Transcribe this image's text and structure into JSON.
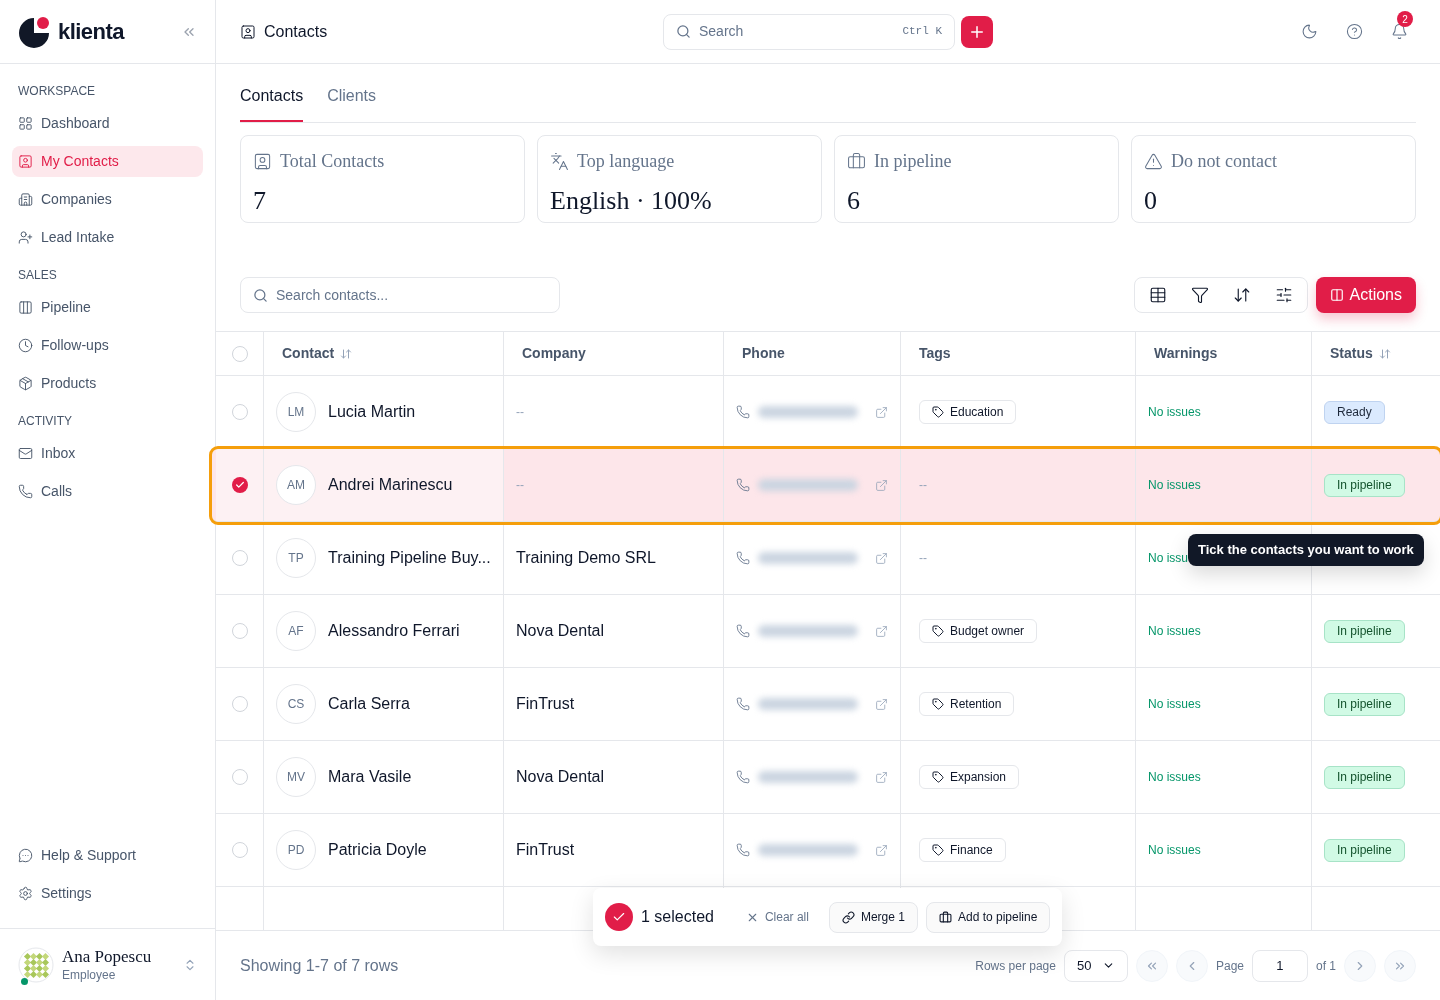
{
  "sidebar": {
    "logo": "klienta",
    "sections": [
      {
        "title": "WORKSPACE",
        "items": [
          {
            "label": "Dashboard",
            "selected": false
          },
          {
            "label": "My Contacts",
            "selected": true
          },
          {
            "label": "Companies",
            "selected": false
          },
          {
            "label": "Lead Intake",
            "selected": false
          }
        ]
      },
      {
        "title": "SALES",
        "items": [
          {
            "label": "Pipeline",
            "selected": false
          },
          {
            "label": "Follow-ups",
            "selected": false
          },
          {
            "label": "Products",
            "selected": false
          }
        ]
      },
      {
        "title": "ACTIVITY",
        "items": [
          {
            "label": "Inbox",
            "selected": false
          },
          {
            "label": "Calls",
            "selected": false
          }
        ]
      }
    ],
    "footer_items": [
      "Help & Support",
      "Settings"
    ],
    "user": {
      "name": "Ana Popescu",
      "role": "Employee",
      "online": true
    }
  },
  "header": {
    "title": "Contacts",
    "search": {
      "placeholder": "Search",
      "shortcut": "Ctrl K"
    },
    "notification_count": "2"
  },
  "tabs": [
    {
      "label": "Contacts",
      "selected": true
    },
    {
      "label": "Clients",
      "selected": false
    }
  ],
  "stats": [
    {
      "label": "Total Contacts",
      "value": "7"
    },
    {
      "label": "Top language",
      "value": "English · 100%"
    },
    {
      "label": "In pipeline",
      "value": "6"
    },
    {
      "label": "Do not contact",
      "value": "0"
    }
  ],
  "toolbar": {
    "search_placeholder": "Search contacts...",
    "actions": "Actions"
  },
  "table": {
    "select_all": {
      "checked": false
    },
    "columns": [
      {
        "label": "Contact",
        "sortable": true
      },
      {
        "label": "Company",
        "sortable": false
      },
      {
        "label": "Phone",
        "sortable": false
      },
      {
        "label": "Tags",
        "sortable": false
      },
      {
        "label": "Warnings",
        "sortable": false
      },
      {
        "label": "Status",
        "sortable": true
      }
    ],
    "rows": [
      {
        "initials": "LM",
        "name": "Lucia Martin",
        "company": "--",
        "tag": {
          "kind": "tag",
          "label": "Education"
        },
        "warning": "No issues",
        "status": {
          "kind": "ready",
          "label": "Ready"
        },
        "selected": false
      },
      {
        "initials": "AM",
        "name": "Andrei Marinescu",
        "company": "--",
        "tag": {
          "kind": "empty",
          "label": "--"
        },
        "warning": "No issues",
        "status": {
          "kind": "pipeline",
          "label": "In pipeline"
        },
        "selected": true
      },
      {
        "initials": "TP",
        "name": "Training Pipeline Buy...",
        "company": "Training Demo SRL",
        "tag": {
          "kind": "empty",
          "label": "--"
        },
        "warning": "No issu",
        "selected": false
      },
      {
        "initials": "AF",
        "name": "Alessandro Ferrari",
        "company": "Nova Dental",
        "tag": {
          "kind": "tag",
          "label": "Budget owner"
        },
        "warning": "No issues",
        "status": {
          "kind": "pipeline",
          "label": "In pipeline"
        },
        "selected": false
      },
      {
        "initials": "CS",
        "name": "Carla Serra",
        "company": "FinTrust",
        "tag": {
          "kind": "tag",
          "label": "Retention"
        },
        "warning": "No issues",
        "status": {
          "kind": "pipeline",
          "label": "In pipeline"
        },
        "selected": false
      },
      {
        "initials": "MV",
        "name": "Mara Vasile",
        "company": "Nova Dental",
        "tag": {
          "kind": "tag",
          "label": "Expansion"
        },
        "warning": "No issues",
        "status": {
          "kind": "pipeline",
          "label": "In pipeline"
        },
        "selected": false
      },
      {
        "initials": "PD",
        "name": "Patricia Doyle",
        "company": "FinTrust",
        "tag": {
          "kind": "tag",
          "label": "Finance"
        },
        "warning": "No issues",
        "status": {
          "kind": "pipeline",
          "label": "In pipeline"
        },
        "selected": false
      }
    ]
  },
  "tooltip": "Tick the contacts you want to work",
  "selection_bar": {
    "count": "1 selected",
    "clear": "Clear all",
    "merge": "Merge 1",
    "add": "Add to pipeline"
  },
  "footer": {
    "summary": "Showing 1-7 of 7 rows",
    "rows_per_page_label": "Rows per page",
    "rows_per_page": "50",
    "page_label": "Page",
    "page": "1",
    "page_total": "of 1"
  }
}
